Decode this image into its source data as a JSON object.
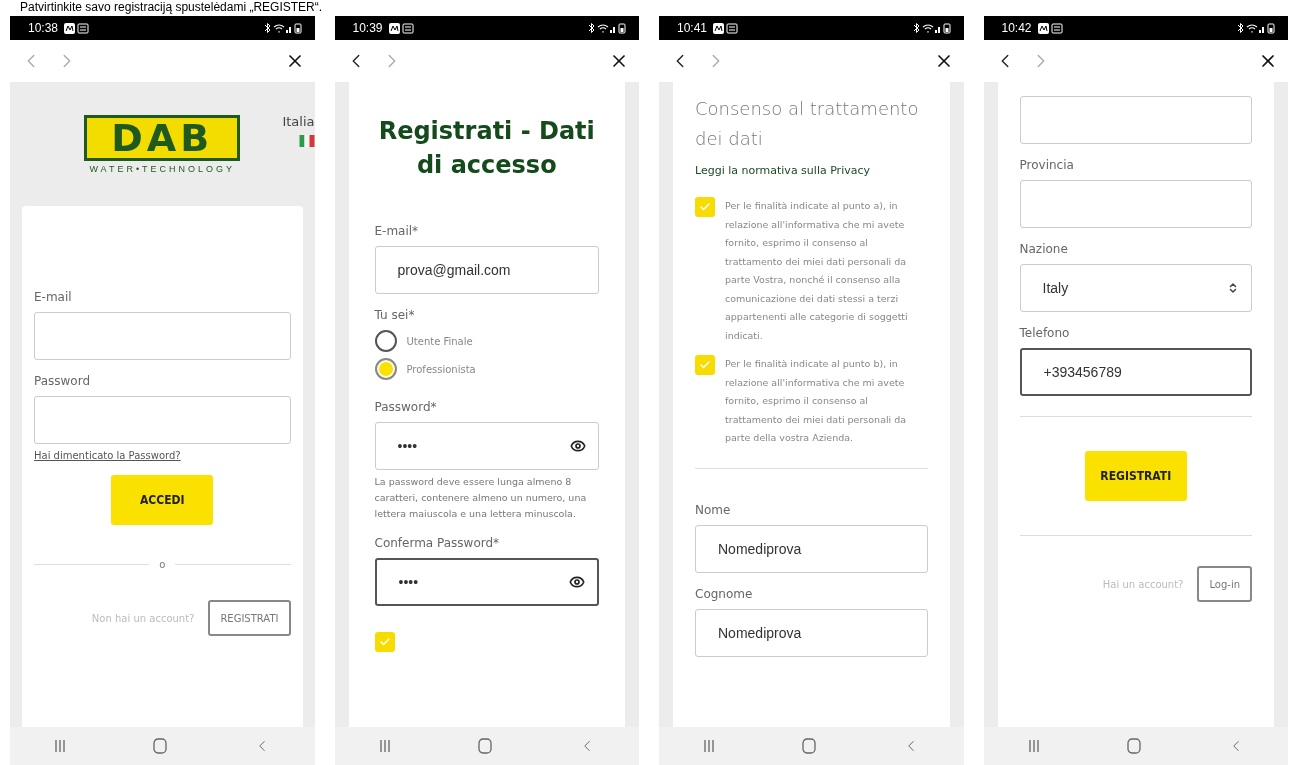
{
  "caption": "Patvirtinkite savo registraciją spustelėdami „REGISTER“.",
  "phones": [
    {
      "time": "10:38",
      "header": {
        "logo": "DAB",
        "tagline": "WATER•TECHNOLOGY",
        "language": "Italia"
      },
      "blocks": [
        {
          "kind": "label",
          "text": "E-mail"
        },
        {
          "kind": "field",
          "focused": false
        },
        {
          "kind": "label",
          "text": "Password"
        },
        {
          "kind": "field",
          "focused": false
        },
        {
          "kind": "link",
          "text": "Hai dimenticato la Password?"
        },
        {
          "kind": "button",
          "text": "ACCEDI"
        },
        {
          "kind": "divider",
          "text": "o"
        },
        {
          "kind": "footer",
          "text": "Non hai un account?",
          "button": "REGISTRATI"
        }
      ]
    },
    {
      "time": "10:39",
      "blocks": [
        {
          "kind": "heading",
          "text": "Registrati - Dati di accesso"
        },
        {
          "kind": "label",
          "text": "E-mail*"
        },
        {
          "kind": "field",
          "value": "prova@gmail.com",
          "focused": false
        },
        {
          "kind": "label",
          "text": "Tu sei*"
        },
        {
          "kind": "radio",
          "text": "Utente Finale",
          "selected": false
        },
        {
          "kind": "radio",
          "text": "Professionista",
          "selected": true
        },
        {
          "kind": "label",
          "text": "Password*"
        },
        {
          "kind": "password",
          "value": "••••",
          "focused": false
        },
        {
          "kind": "note",
          "text": "La password deve essere lunga almeno 8 caratteri, contenere almeno un numero, una lettera maiuscola e una lettera minuscola."
        },
        {
          "kind": "label",
          "text": "Conferma Password*"
        },
        {
          "kind": "password",
          "value": "••••",
          "focused": true
        },
        {
          "kind": "checkbox",
          "checked": true
        }
      ]
    },
    {
      "time": "10:41",
      "blocks": [
        {
          "kind": "title",
          "text": "Consenso al trattamento dei dati"
        },
        {
          "kind": "link",
          "text": "Leggi la normativa sulla Privacy"
        },
        {
          "kind": "checkbox",
          "text": "Per le finalità indicate al punto a), in relazione all'informativa che mi avete fornito, esprimo il consenso al trattamento dei miei dati personali da parte Vostra, nonché il consenso alla comunicazione dei dati stessi a terzi appartenenti alle categorie di soggetti indicati.",
          "checked": true
        },
        {
          "kind": "checkbox",
          "text": "Per le finalità indicate al punto b), in relazione all'informativa che mi avete fornito, esprimo il consenso al trattamento dei miei dati personali da parte della vostra Azienda.",
          "checked": true
        },
        {
          "kind": "divider"
        },
        {
          "kind": "label",
          "text": "Nome"
        },
        {
          "kind": "field",
          "value": "Nomediprova",
          "focused": false
        },
        {
          "kind": "label",
          "text": "Cognome"
        },
        {
          "kind": "field",
          "value": "Nomediprova",
          "focused": false
        }
      ]
    },
    {
      "time": "10:42",
      "blocks": [
        {
          "kind": "field",
          "focused": false
        },
        {
          "kind": "label",
          "text": "Provincia"
        },
        {
          "kind": "field",
          "focused": false
        },
        {
          "kind": "label",
          "text": "Nazione"
        },
        {
          "kind": "select",
          "value": "Italy",
          "focused": false
        },
        {
          "kind": "label",
          "text": "Telefono"
        },
        {
          "kind": "field",
          "value": "+393456789",
          "focused": true
        },
        {
          "kind": "divider"
        },
        {
          "kind": "button",
          "text": "REGISTRATI"
        },
        {
          "kind": "divider"
        },
        {
          "kind": "footer",
          "text": "Hai un account?",
          "button": "Log-in"
        }
      ]
    }
  ]
}
